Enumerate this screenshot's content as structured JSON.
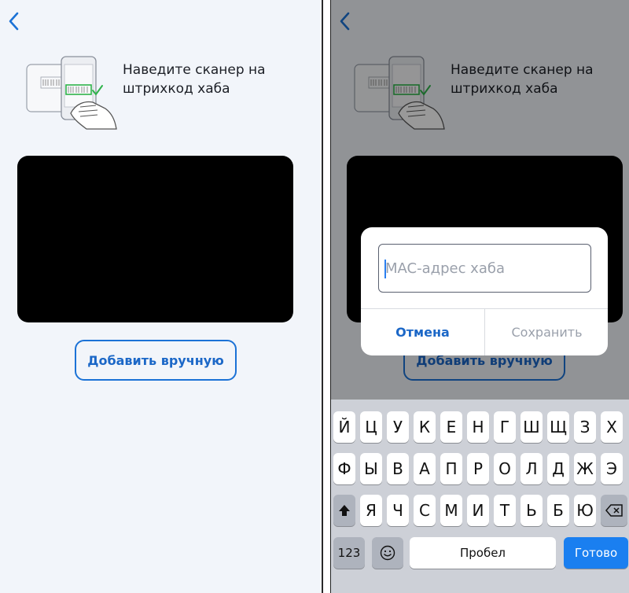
{
  "instruction": "Наведите сканер на штрихкод хаба",
  "add_manual_label": "Добавить вручную",
  "dialog": {
    "input_placeholder": "MAC-адрес хаба",
    "cancel_label": "Отмена",
    "save_label": "Сохранить"
  },
  "keyboard": {
    "row1": [
      "Й",
      "Ц",
      "У",
      "К",
      "Е",
      "Н",
      "Г",
      "Ш",
      "Щ",
      "З",
      "Х"
    ],
    "row2": [
      "Ф",
      "Ы",
      "В",
      "А",
      "П",
      "Р",
      "О",
      "Л",
      "Д",
      "Ж",
      "Э"
    ],
    "row3": [
      "Я",
      "Ч",
      "С",
      "М",
      "И",
      "Т",
      "Ь",
      "Б",
      "Ю"
    ],
    "numbers_label": "123",
    "space_label": "Пробел",
    "done_label": "Готово"
  },
  "colors": {
    "accent": "#1b67c7",
    "background": "#f2f5fa",
    "done_key": "#1a7ff0"
  }
}
